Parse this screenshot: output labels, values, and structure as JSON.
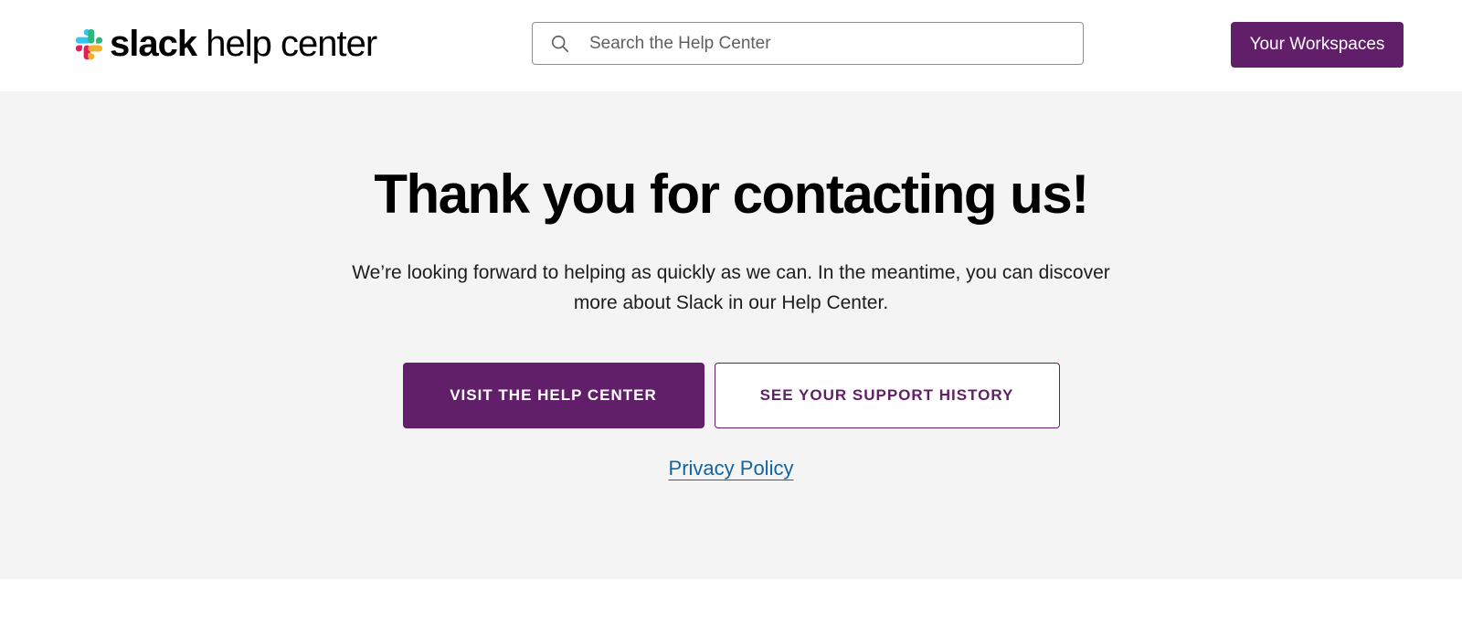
{
  "header": {
    "logo_bold": "slack",
    "logo_rest": " help center",
    "logo_icon": "slack-logo-icon",
    "search": {
      "placeholder": "Search the Help Center",
      "value": "",
      "icon": "search-icon"
    },
    "workspaces_label": "Your Workspaces"
  },
  "main": {
    "title": "Thank you for contacting us!",
    "subtitle_line1": "We’re looking forward to helping as quickly as we can. In the meantime, you can discover",
    "subtitle_line2": "more about Slack in our Help Center.",
    "primary_button": "VISIT THE HELP CENTER",
    "secondary_button": "SEE YOUR SUPPORT HISTORY",
    "privacy_link": "Privacy Policy"
  },
  "colors": {
    "brand_purple": "#611f69",
    "link_blue": "#1264a3",
    "panel_gray": "#f4f4f4"
  }
}
